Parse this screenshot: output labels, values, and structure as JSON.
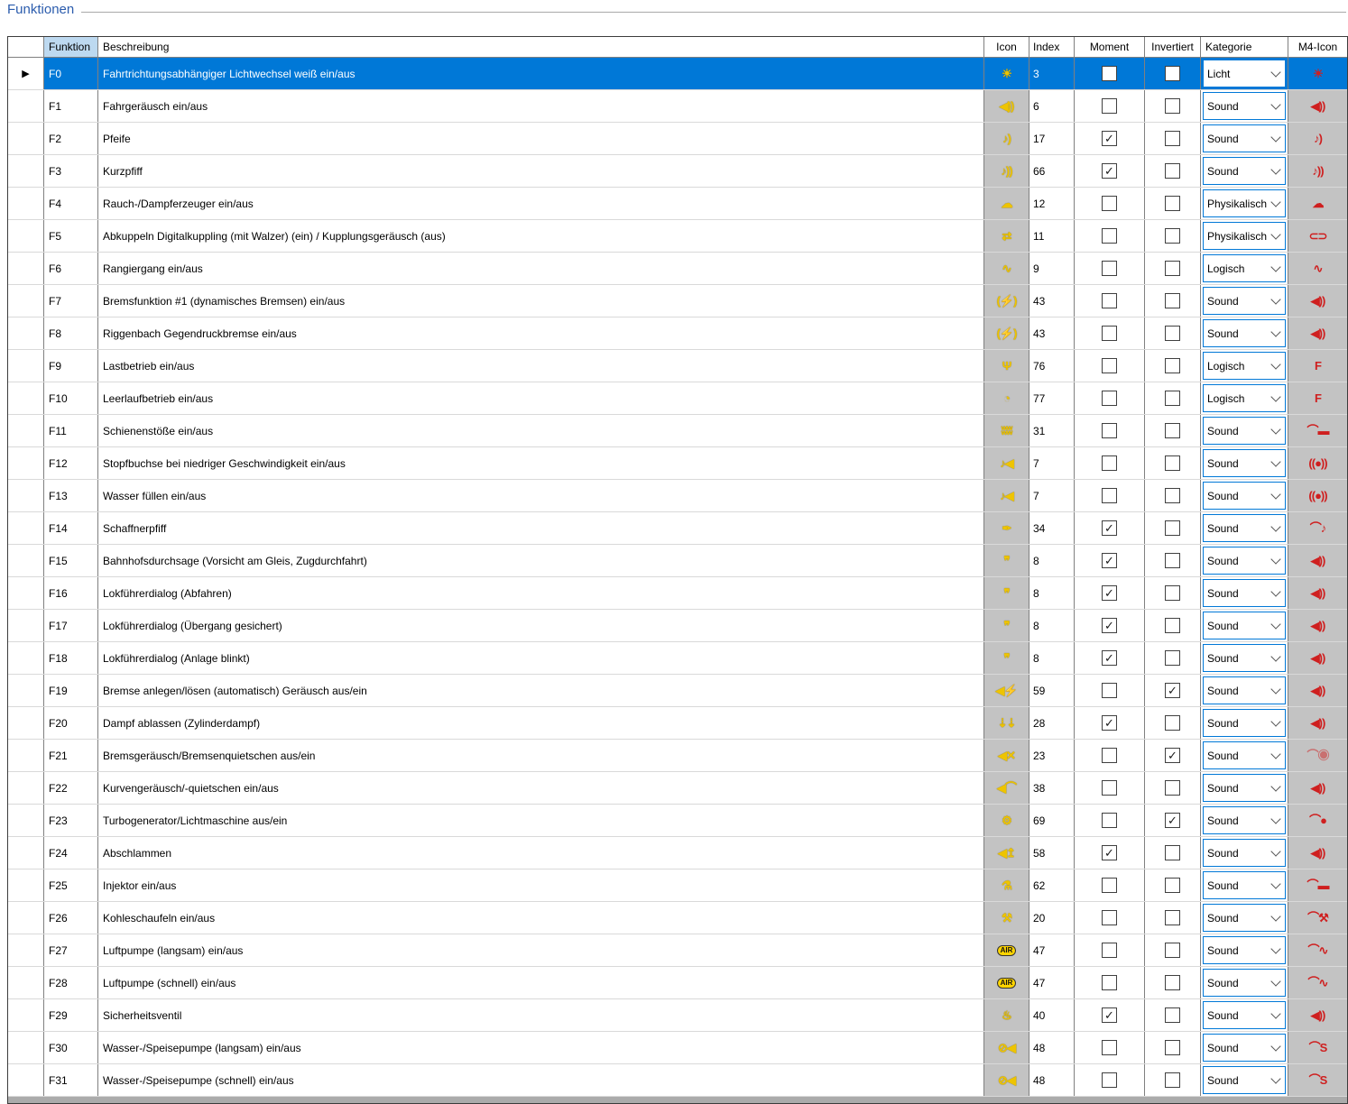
{
  "title": "Funktionen",
  "ui": {
    "row_marker": "▶",
    "checkmark": "✓"
  },
  "colors": {
    "selection_blue": "#0078d7",
    "icon_column_gray": "#c3c3c3",
    "function_icon_yellow": "#eec400",
    "m4_icon_red": "#cf1f1f",
    "sorted_header_blue": "#bdd9f0",
    "title_blue": "#2b5cad"
  },
  "table": {
    "columns": [
      "Funktion",
      "Beschreibung",
      "Icon",
      "Index",
      "Moment",
      "Invertiert",
      "Kategorie",
      "M4-Icon"
    ],
    "rows": [
      {
        "selected": true,
        "funktion": "F0",
        "beschreibung": "Fahrtrichtungsabhängiger Lichtwechsel weiß ein/aus",
        "icon": {
          "name": "headlight-icon",
          "glyph": "☀"
        },
        "index": "3",
        "moment": false,
        "invertiert": false,
        "kategorie": "Licht",
        "m4_icon": {
          "name": "m4-light-icon",
          "glyph": "☀"
        }
      },
      {
        "selected": false,
        "funktion": "F1",
        "beschreibung": "Fahrgeräusch ein/aus",
        "icon": {
          "name": "drive-sound-icon",
          "glyph": "◀))"
        },
        "index": "6",
        "moment": false,
        "invertiert": false,
        "kategorie": "Sound",
        "m4_icon": {
          "name": "m4-speaker-icon",
          "glyph": "◀))"
        }
      },
      {
        "selected": false,
        "funktion": "F2",
        "beschreibung": "Pfeife",
        "icon": {
          "name": "whistle-icon",
          "glyph": "♪)"
        },
        "index": "17",
        "moment": true,
        "invertiert": false,
        "kategorie": "Sound",
        "m4_icon": {
          "name": "m4-whistle-icon",
          "glyph": "♪)"
        }
      },
      {
        "selected": false,
        "funktion": "F3",
        "beschreibung": "Kurzpfiff",
        "icon": {
          "name": "short-whistle-icon",
          "glyph": "♪))"
        },
        "index": "66",
        "moment": true,
        "invertiert": false,
        "kategorie": "Sound",
        "m4_icon": {
          "name": "m4-short-whistle-icon",
          "glyph": "♪))"
        }
      },
      {
        "selected": false,
        "funktion": "F4",
        "beschreibung": "Rauch-/Dampferzeuger ein/aus",
        "icon": {
          "name": "smoke-generator-icon",
          "glyph": "☁"
        },
        "index": "12",
        "moment": false,
        "invertiert": false,
        "kategorie": "Physikalisch",
        "m4_icon": {
          "name": "m4-smoke-icon",
          "glyph": "☁"
        }
      },
      {
        "selected": false,
        "funktion": "F5",
        "beschreibung": "Abkuppeln Digitalkuppling (mit Walzer) (ein) / Kupplungsgeräusch (aus)",
        "icon": {
          "name": "coupler-icon",
          "glyph": "⇄"
        },
        "index": "11",
        "moment": false,
        "invertiert": false,
        "kategorie": "Physikalisch",
        "m4_icon": {
          "name": "m4-coupler-icon",
          "glyph": "⊂⊃"
        }
      },
      {
        "selected": false,
        "funktion": "F6",
        "beschreibung": "Rangiergang ein/aus",
        "icon": {
          "name": "shunting-icon",
          "glyph": "∿"
        },
        "index": "9",
        "moment": false,
        "invertiert": false,
        "kategorie": "Logisch",
        "m4_icon": {
          "name": "m4-shunting-icon",
          "glyph": "∿"
        }
      },
      {
        "selected": false,
        "funktion": "F7",
        "beschreibung": "Bremsfunktion #1 (dynamisches Bremsen) ein/aus",
        "icon": {
          "name": "brake-icon",
          "glyph": "(⚡)"
        },
        "index": "43",
        "moment": false,
        "invertiert": false,
        "kategorie": "Sound",
        "m4_icon": {
          "name": "m4-speaker-icon",
          "glyph": "◀))"
        }
      },
      {
        "selected": false,
        "funktion": "F8",
        "beschreibung": "Riggenbach Gegendruckbremse ein/aus",
        "icon": {
          "name": "counter-pressure-brake-icon",
          "glyph": "(⚡)"
        },
        "index": "43",
        "moment": false,
        "invertiert": false,
        "kategorie": "Sound",
        "m4_icon": {
          "name": "m4-speaker-icon",
          "glyph": "◀))"
        }
      },
      {
        "selected": false,
        "funktion": "F9",
        "beschreibung": "Lastbetrieb ein/aus",
        "icon": {
          "name": "load-mode-icon",
          "glyph": "Ψ"
        },
        "index": "76",
        "moment": false,
        "invertiert": false,
        "kategorie": "Logisch",
        "m4_icon": {
          "name": "m4-logic-f-icon",
          "glyph": "F"
        }
      },
      {
        "selected": false,
        "funktion": "F10",
        "beschreibung": "Leerlaufbetrieb ein/aus",
        "icon": {
          "name": "idle-mode-icon",
          "glyph": "◔"
        },
        "index": "77",
        "moment": false,
        "invertiert": false,
        "kategorie": "Logisch",
        "m4_icon": {
          "name": "m4-logic-f-icon",
          "glyph": "F"
        }
      },
      {
        "selected": false,
        "funktion": "F11",
        "beschreibung": "Schienenstöße ein/aus",
        "icon": {
          "name": "rail-joints-icon",
          "glyph": "ʬʬ"
        },
        "index": "31",
        "moment": false,
        "invertiert": false,
        "kategorie": "Sound",
        "m4_icon": {
          "name": "m4-rail-joints-icon",
          "glyph": "⌒▬"
        }
      },
      {
        "selected": false,
        "funktion": "F12",
        "beschreibung": "Stopfbuchse bei niedriger Geschwindigkeit ein/aus",
        "icon": {
          "name": "gland-sound-icon",
          "glyph": "♪◀"
        },
        "index": "7",
        "moment": false,
        "invertiert": false,
        "kategorie": "Sound",
        "m4_icon": {
          "name": "m4-lock-sound-icon",
          "glyph": "((●))"
        }
      },
      {
        "selected": false,
        "funktion": "F13",
        "beschreibung": "Wasser füllen ein/aus",
        "icon": {
          "name": "water-fill-icon",
          "glyph": "♪◀"
        },
        "index": "7",
        "moment": false,
        "invertiert": false,
        "kategorie": "Sound",
        "m4_icon": {
          "name": "m4-lock-sound-icon",
          "glyph": "((●))"
        }
      },
      {
        "selected": false,
        "funktion": "F14",
        "beschreibung": "Schaffnerpfiff",
        "icon": {
          "name": "conductor-whistle-icon",
          "glyph": "✒"
        },
        "index": "34",
        "moment": true,
        "invertiert": false,
        "kategorie": "Sound",
        "m4_icon": {
          "name": "m4-conductor-whistle-icon",
          "glyph": "⌒♪"
        }
      },
      {
        "selected": false,
        "funktion": "F15",
        "beschreibung": "Bahnhofsdurchsage (Vorsicht am Gleis, Zugdurchfahrt)",
        "icon": {
          "name": "announcement-dialog-icon",
          "glyph": "❞"
        },
        "index": "8",
        "moment": true,
        "invertiert": false,
        "kategorie": "Sound",
        "m4_icon": {
          "name": "m4-speaker-icon",
          "glyph": "◀))"
        }
      },
      {
        "selected": false,
        "funktion": "F16",
        "beschreibung": "Lokführerdialog (Abfahren)",
        "icon": {
          "name": "driver-dialog-icon",
          "glyph": "❞"
        },
        "index": "8",
        "moment": true,
        "invertiert": false,
        "kategorie": "Sound",
        "m4_icon": {
          "name": "m4-speaker-icon",
          "glyph": "◀))"
        }
      },
      {
        "selected": false,
        "funktion": "F17",
        "beschreibung": "Lokführerdialog (Übergang gesichert)",
        "icon": {
          "name": "driver-dialog-icon",
          "glyph": "❞"
        },
        "index": "8",
        "moment": true,
        "invertiert": false,
        "kategorie": "Sound",
        "m4_icon": {
          "name": "m4-speaker-icon",
          "glyph": "◀))"
        }
      },
      {
        "selected": false,
        "funktion": "F18",
        "beschreibung": "Lokführerdialog (Anlage blinkt)",
        "icon": {
          "name": "driver-dialog-icon",
          "glyph": "❞"
        },
        "index": "8",
        "moment": true,
        "invertiert": false,
        "kategorie": "Sound",
        "m4_icon": {
          "name": "m4-speaker-icon",
          "glyph": "◀))"
        }
      },
      {
        "selected": false,
        "funktion": "F19",
        "beschreibung": "Bremse anlegen/lösen (automatisch) Geräusch aus/ein",
        "icon": {
          "name": "brake-apply-release-icon",
          "glyph": "◀⚡"
        },
        "index": "59",
        "moment": false,
        "invertiert": true,
        "kategorie": "Sound",
        "m4_icon": {
          "name": "m4-speaker-icon",
          "glyph": "◀))"
        }
      },
      {
        "selected": false,
        "funktion": "F20",
        "beschreibung": "Dampf ablassen (Zylinderdampf)",
        "icon": {
          "name": "cylinder-steam-icon",
          "glyph": "⇣⇣"
        },
        "index": "28",
        "moment": true,
        "invertiert": false,
        "kategorie": "Sound",
        "m4_icon": {
          "name": "m4-speaker-icon",
          "glyph": "◀))"
        }
      },
      {
        "selected": false,
        "funktion": "F21",
        "beschreibung": "Bremsgeräusch/Bremsenquietschen aus/ein",
        "icon": {
          "name": "brake-squeal-off-icon",
          "glyph": "◀✕"
        },
        "index": "23",
        "moment": false,
        "invertiert": true,
        "kategorie": "Sound",
        "m4_icon": {
          "name": "m4-brake-squeal-icon",
          "glyph": "⌒◉",
          "dim": true
        }
      },
      {
        "selected": false,
        "funktion": "F22",
        "beschreibung": "Kurvengeräusch/-quietschen ein/aus",
        "icon": {
          "name": "curve-squeal-icon",
          "glyph": "◀⌒"
        },
        "index": "38",
        "moment": false,
        "invertiert": false,
        "kategorie": "Sound",
        "m4_icon": {
          "name": "m4-speaker-icon",
          "glyph": "◀))"
        }
      },
      {
        "selected": false,
        "funktion": "F23",
        "beschreibung": "Turbogenerator/Lichtmaschine aus/ein",
        "icon": {
          "name": "turbo-generator-icon",
          "glyph": "⚙"
        },
        "index": "69",
        "moment": false,
        "invertiert": true,
        "kategorie": "Sound",
        "m4_icon": {
          "name": "m4-generator-icon",
          "glyph": "⌒●"
        }
      },
      {
        "selected": false,
        "funktion": "F24",
        "beschreibung": "Abschlammen",
        "icon": {
          "name": "blowdown-icon",
          "glyph": "◀↥"
        },
        "index": "58",
        "moment": true,
        "invertiert": false,
        "kategorie": "Sound",
        "m4_icon": {
          "name": "m4-speaker-icon",
          "glyph": "◀))"
        }
      },
      {
        "selected": false,
        "funktion": "F25",
        "beschreibung": "Injektor ein/aus",
        "icon": {
          "name": "injector-icon",
          "glyph": "⚗"
        },
        "index": "62",
        "moment": false,
        "invertiert": false,
        "kategorie": "Sound",
        "m4_icon": {
          "name": "m4-injector-icon",
          "glyph": "⌒▬"
        }
      },
      {
        "selected": false,
        "funktion": "F26",
        "beschreibung": "Kohleschaufeln ein/aus",
        "icon": {
          "name": "coal-shovel-icon",
          "glyph": "⚒"
        },
        "index": "20",
        "moment": false,
        "invertiert": false,
        "kategorie": "Sound",
        "m4_icon": {
          "name": "m4-coal-shovel-icon",
          "glyph": "⌒⚒"
        }
      },
      {
        "selected": false,
        "funktion": "F27",
        "beschreibung": "Luftpumpe (langsam) ein/aus",
        "icon": {
          "name": "air-pump-icon",
          "glyph": "AIR",
          "pill": true
        },
        "index": "47",
        "moment": false,
        "invertiert": false,
        "kategorie": "Sound",
        "m4_icon": {
          "name": "m4-air-pump-icon",
          "glyph": "⌒∿"
        }
      },
      {
        "selected": false,
        "funktion": "F28",
        "beschreibung": "Luftpumpe (schnell) ein/aus",
        "icon": {
          "name": "air-pump-icon",
          "glyph": "AIR",
          "pill": true
        },
        "index": "47",
        "moment": false,
        "invertiert": false,
        "kategorie": "Sound",
        "m4_icon": {
          "name": "m4-air-pump-icon",
          "glyph": "⌒∿"
        }
      },
      {
        "selected": false,
        "funktion": "F29",
        "beschreibung": "Sicherheitsventil",
        "icon": {
          "name": "safety-valve-icon",
          "glyph": "♨"
        },
        "index": "40",
        "moment": true,
        "invertiert": false,
        "kategorie": "Sound",
        "m4_icon": {
          "name": "m4-speaker-icon",
          "glyph": "◀))"
        }
      },
      {
        "selected": false,
        "funktion": "F30",
        "beschreibung": "Wasser-/Speisepumpe (langsam) ein/aus",
        "icon": {
          "name": "water-pump-icon",
          "glyph": "⊘◀"
        },
        "index": "48",
        "moment": false,
        "invertiert": false,
        "kategorie": "Sound",
        "m4_icon": {
          "name": "m4-water-pump-icon",
          "glyph": "⌒S"
        }
      },
      {
        "selected": false,
        "funktion": "F31",
        "beschreibung": "Wasser-/Speisepumpe (schnell) ein/aus",
        "icon": {
          "name": "water-pump-icon",
          "glyph": "⊘◀"
        },
        "index": "48",
        "moment": false,
        "invertiert": false,
        "kategorie": "Sound",
        "m4_icon": {
          "name": "m4-water-pump-icon",
          "glyph": "⌒S"
        }
      }
    ]
  }
}
